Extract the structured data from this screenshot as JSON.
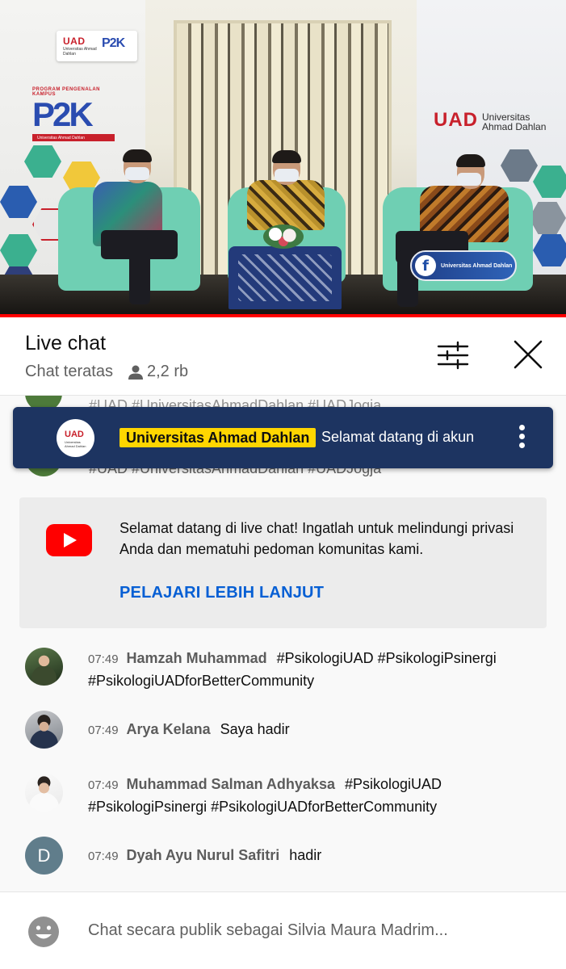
{
  "video": {
    "uad_logo_text": "UAD",
    "uad_logo_sub": "Universitas Ahmad Dahlan",
    "p2k_logo_text": "P2K",
    "banner_caption": "PROGRAM PENGENALAN KAMPUS",
    "banner_big": "P2K",
    "banner_bar": "Universitas Ahmad Dahlan",
    "right_logo_abbr": "UAD",
    "right_logo_name_line1": "Universitas",
    "right_logo_name_line2": "Ahmad Dahlan",
    "facebook_badge": "Universitas Ahmad Dahlan",
    "accent_color": "#ff0000"
  },
  "chat_header": {
    "title": "Live chat",
    "mode": "Chat teratas",
    "viewer_count": "2,2 rb",
    "icons": {
      "viewers": "person-icon",
      "filter": "sliders-icon",
      "close": "close-icon"
    }
  },
  "ghost_rows": {
    "top": "#UAD #UniversitasAhmadDahlan #UADJogja",
    "bottom": "#UAD #UniversitasAhmadDahlan #UADJogja"
  },
  "pinned": {
    "avatar_abbr": "UAD",
    "avatar_sub": "Universitas Ahmad Dahlan",
    "owner": "Universitas Ahmad Dahlan",
    "message": "Selamat datang di akun",
    "owner_badge_color": "#ffd600",
    "background_color": "#1d3461"
  },
  "welcome": {
    "text": "Selamat datang di live chat! Ingatlah untuk melindungi privasi Anda dan mematuhi pedoman komunitas kami.",
    "link": "PELAJARI LEBIH LANJUT",
    "link_color": "#065fd4",
    "icon": "youtube-icon"
  },
  "messages": [
    {
      "time": "07:49",
      "author": "Hamzah Muhammad",
      "text": "#PsikologiUAD #PsikologiPsinergi #PsikologiUADforBetterCommunity"
    },
    {
      "time": "07:49",
      "author": "Arya Kelana",
      "text": "Saya hadir"
    },
    {
      "time": "07:49",
      "author": "Muhammad Salman Adhyaksa",
      "text": "#PsikologiUAD #PsikologiPsinergi #PsikologiUADforBetterCommunity"
    },
    {
      "time": "07:49",
      "author": "Dyah Ayu Nurul Safitri",
      "text": "hadir",
      "avatar_letter": "D"
    }
  ],
  "input": {
    "placeholder": "Chat secara publik sebagai Silvia Maura Madrim...",
    "icon": "emoji-icon"
  }
}
